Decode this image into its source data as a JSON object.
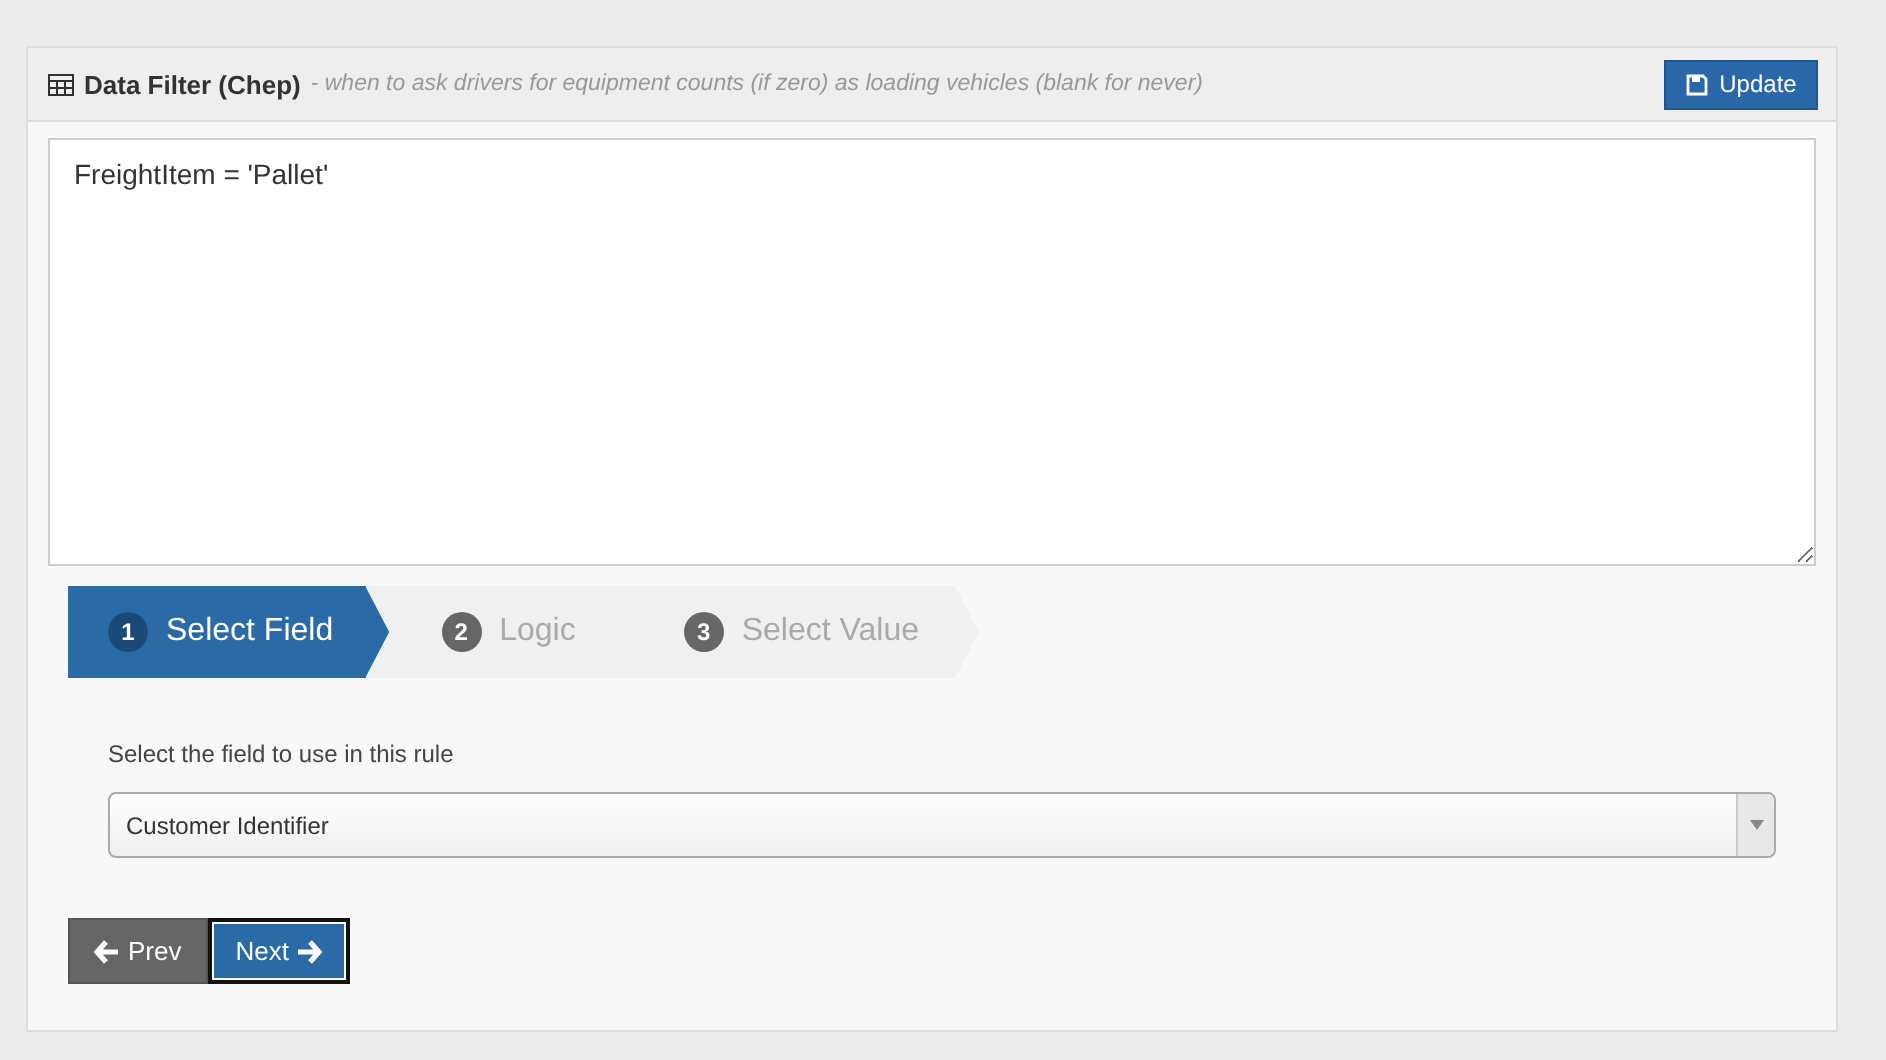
{
  "panel": {
    "title": "Data Filter (Chep)",
    "subtitle": "- when to ask drivers for equipment counts (if zero) as loading vehicles (blank for never)",
    "update_button": "Update"
  },
  "filter_text": "FreightItem = 'Pallet'",
  "steps": [
    {
      "number": "1",
      "label": "Select Field",
      "selected": true
    },
    {
      "number": "2",
      "label": "Logic",
      "selected": false
    },
    {
      "number": "3",
      "label": "Select Value",
      "selected": false
    }
  ],
  "field_label": "Select the field to use in this rule",
  "field_select": {
    "value": "Customer Identifier"
  },
  "buttons": {
    "prev": "Prev",
    "next": "Next"
  }
}
